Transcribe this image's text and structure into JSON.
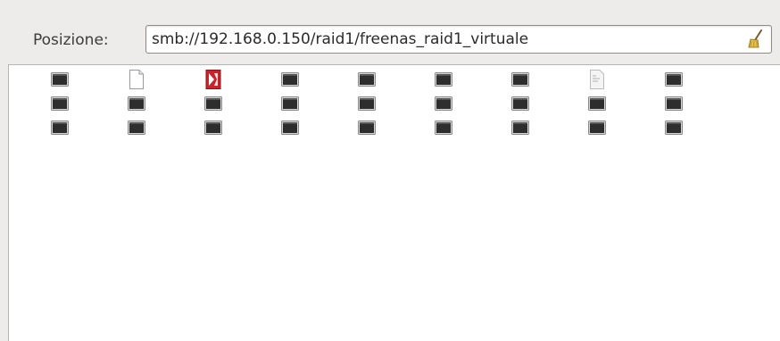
{
  "location_bar": {
    "label": "Posizione:",
    "value": "smb://192.168.0.150/raid1/freenas_raid1_virtuale",
    "clear_icon": "broom-icon"
  },
  "file_view": {
    "columns": 9,
    "rows": 3,
    "items": [
      {
        "icon": "generic-file-icon"
      },
      {
        "icon": "text-document-icon"
      },
      {
        "icon": "pdf-document-icon"
      },
      {
        "icon": "generic-file-icon"
      },
      {
        "icon": "generic-file-icon"
      },
      {
        "icon": "generic-file-icon"
      },
      {
        "icon": "generic-file-icon"
      },
      {
        "icon": "text-preview-icon"
      },
      {
        "icon": "generic-file-icon"
      },
      {
        "icon": "generic-file-icon"
      },
      {
        "icon": "generic-file-icon"
      },
      {
        "icon": "generic-file-icon"
      },
      {
        "icon": "generic-file-icon"
      },
      {
        "icon": "generic-file-icon"
      },
      {
        "icon": "generic-file-icon"
      },
      {
        "icon": "generic-file-icon"
      },
      {
        "icon": "generic-file-icon"
      },
      {
        "icon": "generic-file-icon"
      },
      {
        "icon": "generic-file-icon"
      },
      {
        "icon": "generic-file-icon"
      },
      {
        "icon": "generic-file-icon"
      },
      {
        "icon": "generic-file-icon"
      },
      {
        "icon": "generic-file-icon"
      },
      {
        "icon": "generic-file-icon"
      },
      {
        "icon": "generic-file-icon"
      },
      {
        "icon": "generic-file-icon"
      },
      {
        "icon": "generic-file-icon"
      }
    ]
  },
  "colors": {
    "window_bg": "#edeceb",
    "view_bg": "#ffffff",
    "icon_dark": "#2e2e2e",
    "pdf_red": "#c8242b"
  }
}
